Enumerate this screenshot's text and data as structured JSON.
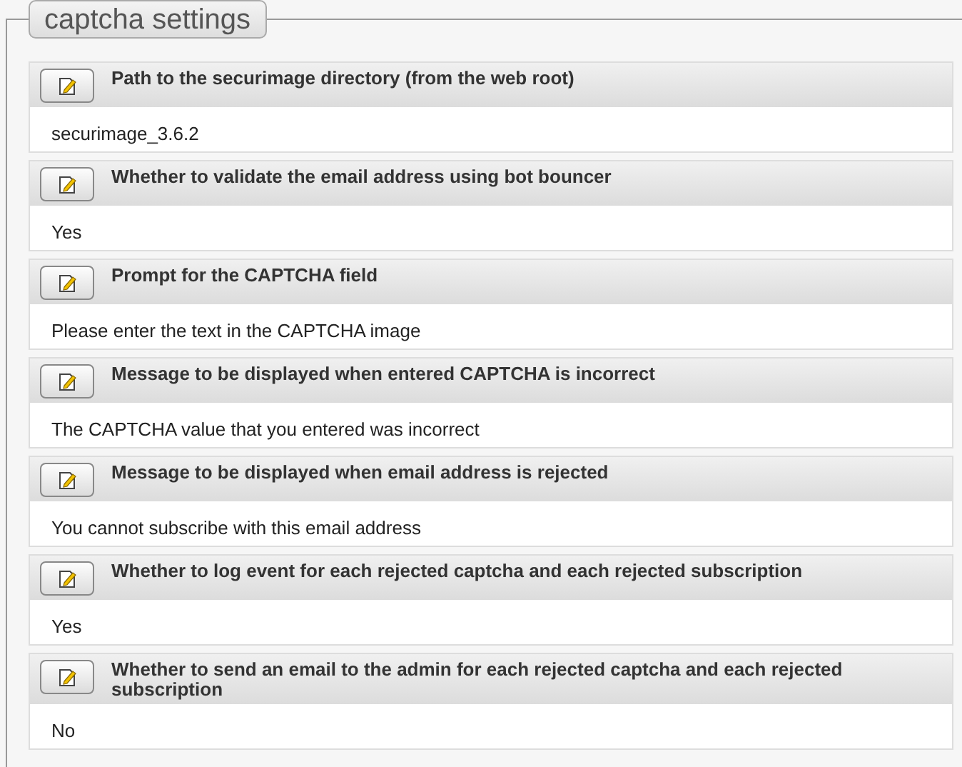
{
  "fieldset": {
    "legend": "captcha settings"
  },
  "settings": [
    {
      "label": "Path to the securimage directory (from the web root)",
      "value": "securimage_3.6.2"
    },
    {
      "label": "Whether to validate the email address using bot bouncer",
      "value": "Yes"
    },
    {
      "label": "Prompt for the CAPTCHA field",
      "value": "Please enter the text in the CAPTCHA image"
    },
    {
      "label": "Message to be displayed when entered CAPTCHA is incorrect",
      "value": "The CAPTCHA value that you entered was incorrect"
    },
    {
      "label": "Message to be displayed when email address is rejected",
      "value": "You cannot subscribe with this email address"
    },
    {
      "label": "Whether to log event for each rejected captcha and each rejected subscription",
      "value": "Yes"
    },
    {
      "label": "Whether to send an email to the admin for each rejected captcha and each rejected subscription",
      "value": "No"
    }
  ]
}
